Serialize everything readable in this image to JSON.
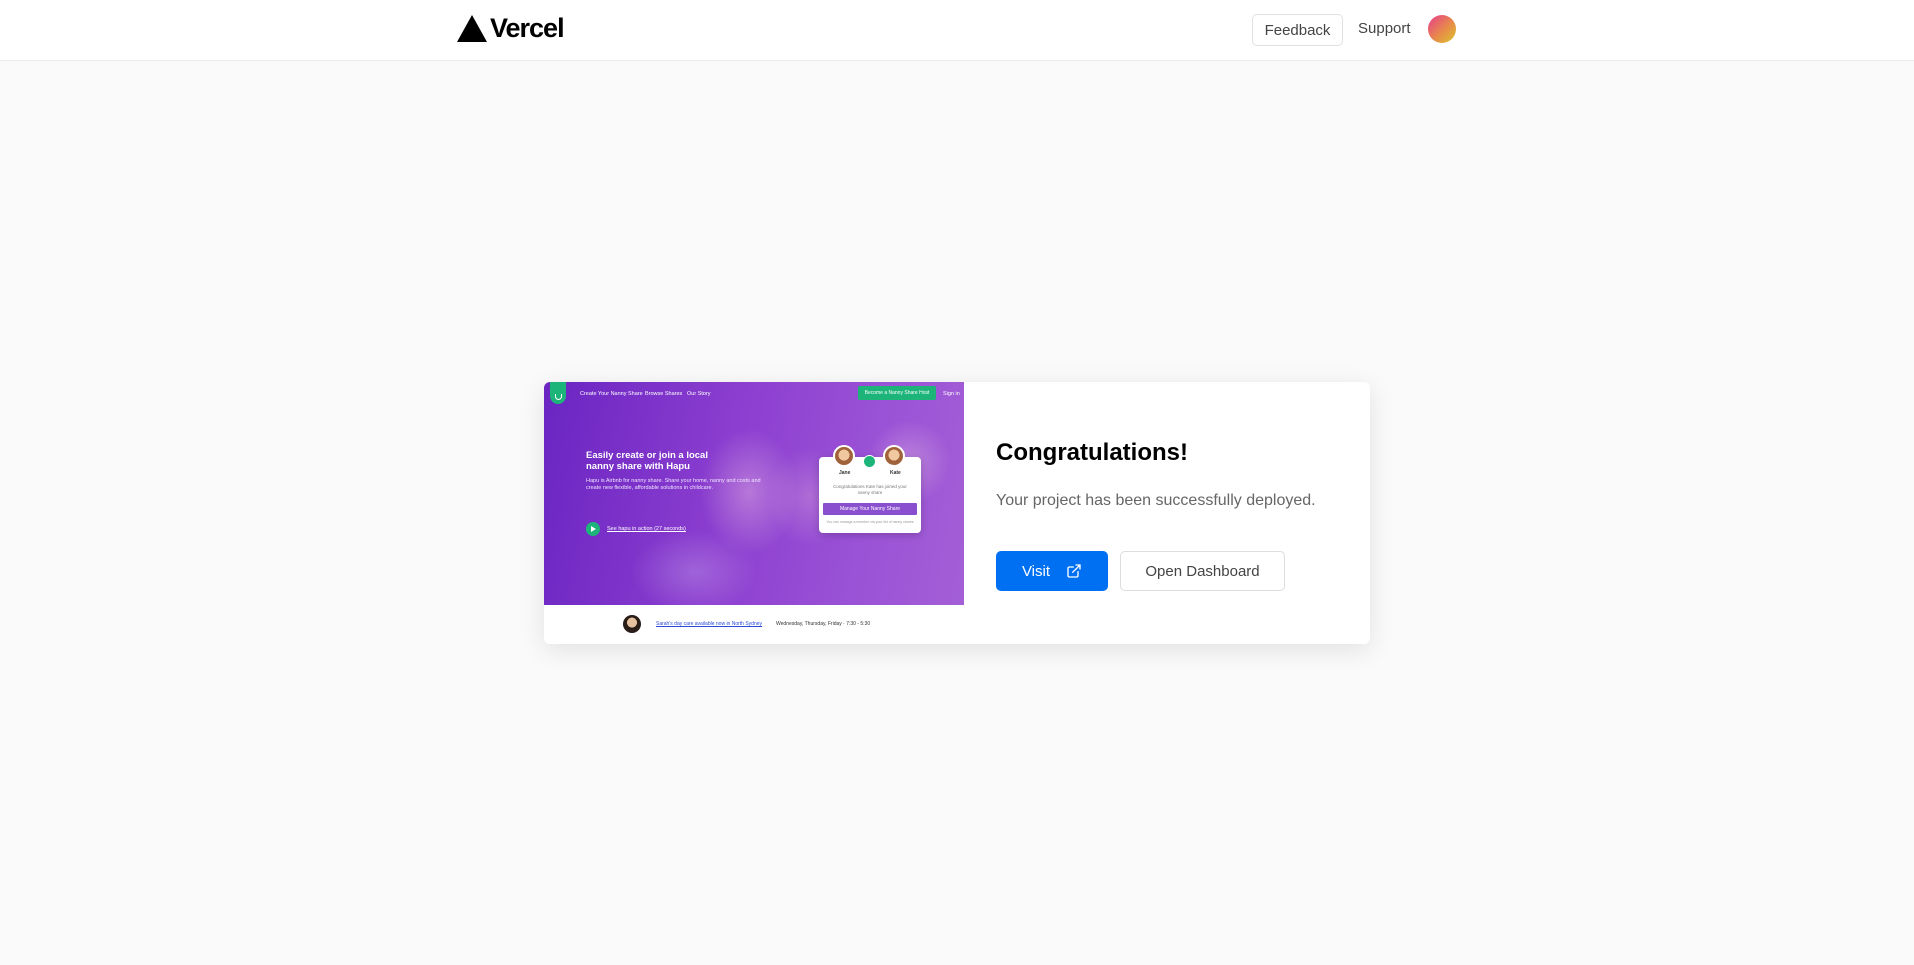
{
  "header": {
    "brand": "Vercel",
    "feedback_label": "Feedback",
    "support_label": "Support"
  },
  "preview": {
    "nav_items": [
      "Create Your Nanny Share",
      "Browse Shares",
      "Our Story"
    ],
    "host_button": "Become a Nanny Share Host",
    "signin": "Sign in",
    "heading": "Easily create or join a local nanny share with Hapu",
    "description": "Hapu is Airbnb for nanny share. Share your home, nanny and costs and create new flexible, affordable solutions in childcare.",
    "video_link": "See hapu in action (27 seconds)",
    "modal": {
      "name_left": "Jane",
      "name_right": "Kate",
      "message": "Congratulations Kate has joined your nanny share",
      "button": "Manage Your Nanny Share",
      "footer": "You can manage a member via your list of nanny shares"
    },
    "bottom_link": "Sarah's day care available now in North Sydney",
    "bottom_times": "Wednesday, Thursday, Friday · 7:30 - 5:30"
  },
  "card": {
    "title": "Congratulations!",
    "subtitle": "Your project has been successfully deployed.",
    "visit_label": "Visit",
    "dashboard_label": "Open Dashboard"
  },
  "colors": {
    "accent": "#0070f3",
    "hapu_green": "#1db47a",
    "hapu_purple": "#7a35c9"
  },
  "icons": {
    "logo": "vercel-triangle-icon",
    "visit": "external-link-icon"
  }
}
